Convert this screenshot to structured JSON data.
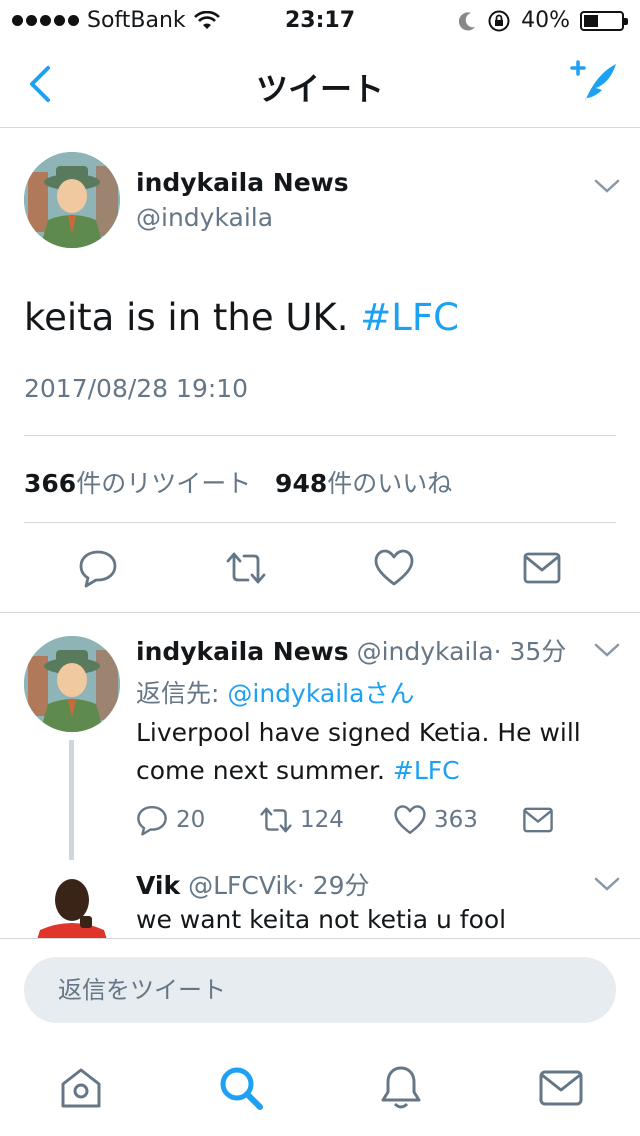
{
  "status_bar": {
    "carrier": "SoftBank",
    "time": "23:17",
    "battery": "40%",
    "battery_level": 0.4
  },
  "nav": {
    "title": "ツイート"
  },
  "main_tweet": {
    "display_name": "indykaila  News",
    "handle": "@indykaila",
    "text": "keita is in the UK.",
    "hashtag": "#LFC",
    "timestamp": "2017/08/28 19:10",
    "retweet_count": "366",
    "retweet_label": "件のリツイート",
    "like_count": "948",
    "like_label": "件のいいね"
  },
  "replies": [
    {
      "display_name": "indykaila  News",
      "handle": "@indykaila",
      "time": "· 35分",
      "reply_to_prefix": "返信先: ",
      "reply_to_handle": "@indykailaさん",
      "text": "Liverpool have signed Ketia. He will come next summer.",
      "hashtag": "#LFC",
      "reply_count": "20",
      "retweet_count": "124",
      "like_count": "363"
    },
    {
      "display_name": "Vik",
      "handle": "@LFCVik",
      "time": "· 29分",
      "text": "we want keita not ketia u fool"
    }
  ],
  "reply_bar": {
    "placeholder": "返信をツイート"
  },
  "colors": {
    "accent": "#1da1f2",
    "secondary_text": "#657786",
    "divider": "#d6d9dc"
  },
  "icons": {
    "back": "chevron-left-icon",
    "compose": "compose-tweet-icon",
    "reply": "reply-icon",
    "retweet": "retweet-icon",
    "like": "heart-icon",
    "dm": "envelope-icon",
    "home": "home-icon",
    "search": "search-icon",
    "notifications": "bell-icon",
    "messages": "envelope-icon"
  }
}
